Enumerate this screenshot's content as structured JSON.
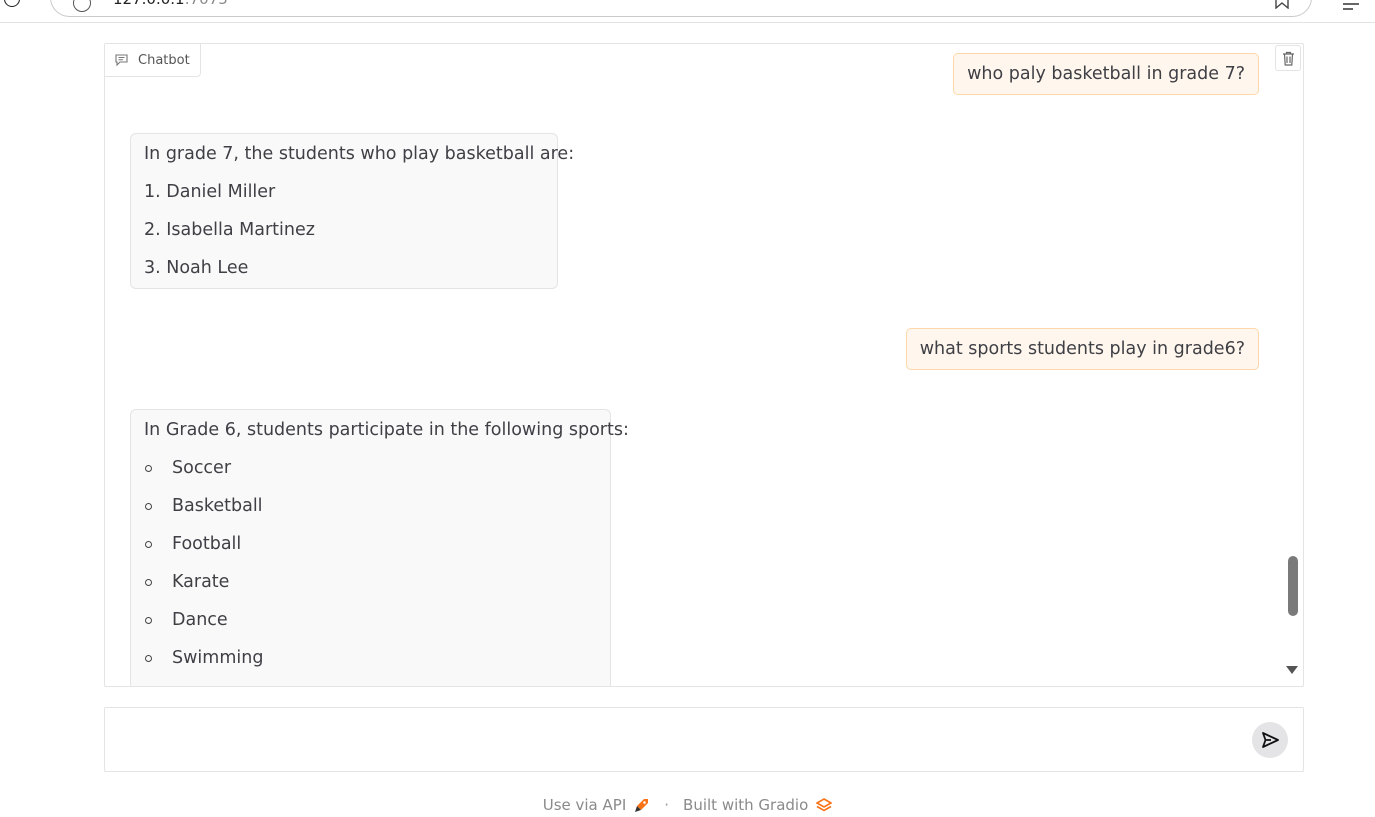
{
  "browser": {
    "url_host": "127.0.0.1",
    "url_port": ":7075"
  },
  "chatbot": {
    "label": "Chatbot",
    "messages": [
      {
        "role": "user",
        "text": "who paly basketball in grade 7?"
      },
      {
        "role": "bot",
        "intro": "In grade 7, the students who play basketball are:",
        "list_type": "ordered",
        "items": [
          "1. Daniel Miller",
          "2. Isabella Martinez",
          "3. Noah Lee"
        ]
      },
      {
        "role": "user",
        "text": "what sports students play in grade6?"
      },
      {
        "role": "bot",
        "intro": "In Grade 6, students participate in the following sports:",
        "list_type": "unordered",
        "items": [
          "Soccer",
          "Basketball",
          "Football",
          "Karate",
          "Dance",
          "Swimming"
        ]
      }
    ]
  },
  "input": {
    "value": "",
    "placeholder": ""
  },
  "footer": {
    "api_label": "Use via API",
    "separator": "·",
    "built_label": "Built with Gradio"
  },
  "colors": {
    "user_bubble_bg": "#fff7ed",
    "user_bubble_border": "#fed7aa",
    "bot_bubble_bg": "#f9f9f9",
    "gradio_orange": "#f97316"
  },
  "icons": {
    "label_icon": "chat-icon",
    "clear": "trash-icon",
    "send": "send-icon",
    "api": "rocket-icon",
    "brand": "gradio-logo-icon"
  }
}
